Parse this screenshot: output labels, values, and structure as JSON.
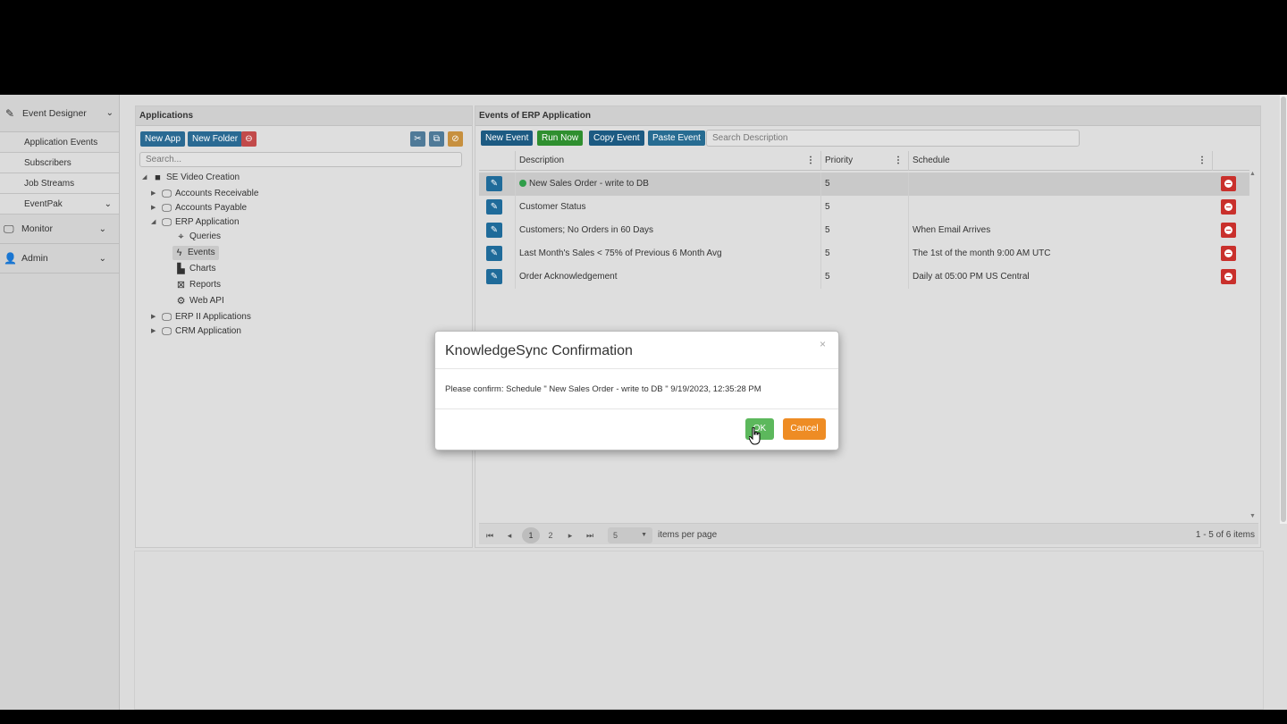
{
  "sidebar": {
    "event_designer": "Event Designer",
    "sub_items": [
      "Application Events",
      "Subscribers",
      "Job Streams",
      "EventPak"
    ],
    "monitor": "Monitor",
    "admin": "Admin"
  },
  "applications": {
    "title": "Applications",
    "new_app": "New App",
    "new_folder": "New Folder",
    "search_placeholder": "Search...",
    "tree": {
      "root": "SE Video Creation",
      "accounts_receivable": "Accounts Receivable",
      "accounts_payable": "Accounts Payable",
      "erp_application": "ERP Application",
      "queries": "Queries",
      "events": "Events",
      "charts": "Charts",
      "reports": "Reports",
      "web_api": "Web API",
      "erp2": "ERP II Applications",
      "crm": "CRM Application"
    }
  },
  "events": {
    "title": "Events of ERP Application",
    "new_event": "New Event",
    "run_now": "Run Now",
    "copy_event": "Copy Event",
    "paste_event": "Paste Event",
    "search_placeholder": "Search Description",
    "columns": {
      "description": "Description",
      "priority": "Priority",
      "schedule": "Schedule"
    },
    "rows": [
      {
        "description": "New Sales Order - write to DB",
        "priority": "5",
        "schedule": ""
      },
      {
        "description": "Customer Status",
        "priority": "5",
        "schedule": ""
      },
      {
        "description": "Customers; No Orders in 60 Days",
        "priority": "5",
        "schedule": "When Email Arrives"
      },
      {
        "description": "Last Month's Sales < 75% of Previous 6 Month Avg",
        "priority": "5",
        "schedule": "The 1st of the month 9:00 AM UTC"
      },
      {
        "description": "Order Acknowledgement",
        "priority": "5",
        "schedule": "Daily at 05:00 PM US Central"
      }
    ],
    "pager": {
      "page1": "1",
      "page2": "2",
      "page_size": "5",
      "items_per_page": "items per page",
      "summary": "1 - 5 of 6 items"
    }
  },
  "modal": {
    "title": "KnowledgeSync Confirmation",
    "close": "×",
    "message": "Please confirm: Schedule \" New Sales Order - write to DB \" 9/19/2023, 12:35:28 PM",
    "ok": "OK",
    "cancel": "Cancel"
  }
}
